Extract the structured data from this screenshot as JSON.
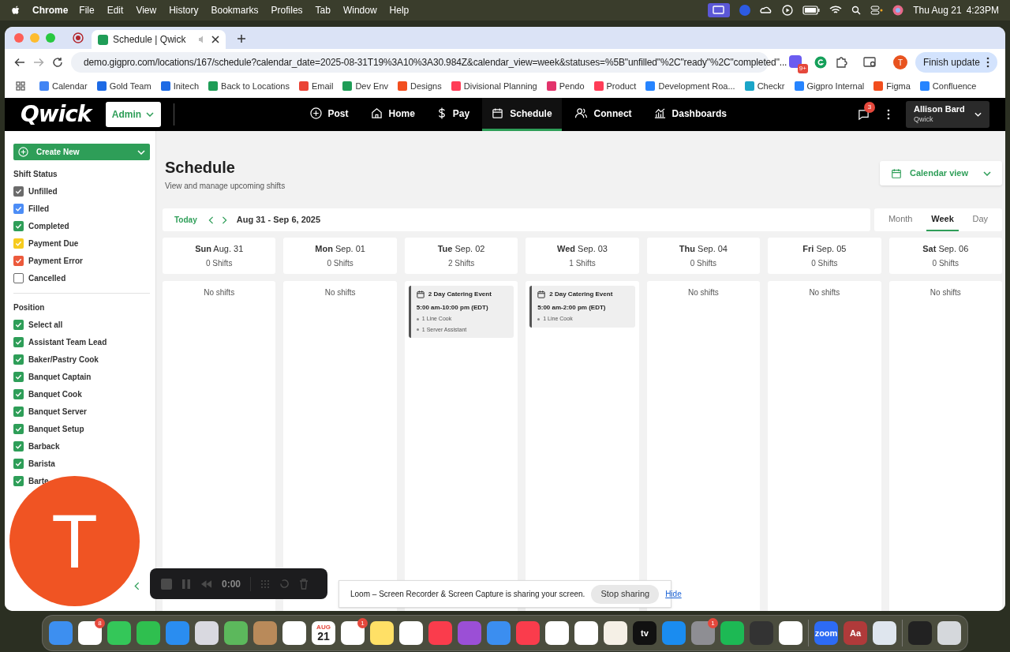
{
  "menubar": {
    "app": "Chrome",
    "menus": [
      "File",
      "Edit",
      "View",
      "History",
      "Bookmarks",
      "Profiles",
      "Tab",
      "Window",
      "Help"
    ],
    "date": "Thu Aug 21",
    "time": "4:23PM"
  },
  "browser": {
    "tab_title": "Schedule | Qwick",
    "url": "demo.gigpro.com/locations/167/schedule?calendar_date=2025-08-31T19%3A10%3A30.984Z&calendar_view=week&statuses=%5B\"unfilled\"%2C\"ready\"%2C\"completed\"...",
    "extension_badge": "9+",
    "profile_initial": "T",
    "update_button": "Finish update",
    "bookmarks": [
      {
        "label": "Calendar",
        "color": "#4285f4"
      },
      {
        "label": "Gold Team",
        "color": "#1d6ae5"
      },
      {
        "label": "Initech",
        "color": "#1d6ae5"
      },
      {
        "label": "Back to Locations",
        "color": "#1f9d57"
      },
      {
        "label": "Email",
        "color": "#ea4335"
      },
      {
        "label": "Dev Env",
        "color": "#1f9d57"
      },
      {
        "label": "Designs",
        "color": "#f24e1e"
      },
      {
        "label": "Divisional Planning",
        "color": "#ff3d57"
      },
      {
        "label": "Pendo",
        "color": "#e2336b"
      },
      {
        "label": "Product",
        "color": "#ff3d57"
      },
      {
        "label": "Development Roa...",
        "color": "#2684ff"
      },
      {
        "label": "Checkr",
        "color": "#1aa5c8"
      },
      {
        "label": "Gigpro Internal",
        "color": "#2684ff"
      },
      {
        "label": "Figma",
        "color": "#f24e1e"
      },
      {
        "label": "Confluence",
        "color": "#2684ff"
      }
    ]
  },
  "app_nav": {
    "logo": "Qwick",
    "role": "Admin",
    "items": [
      {
        "label": "Post",
        "selected": false
      },
      {
        "label": "Home",
        "selected": false
      },
      {
        "label": "Pay",
        "selected": false
      },
      {
        "label": "Schedule",
        "selected": true
      },
      {
        "label": "Connect",
        "selected": false
      },
      {
        "label": "Dashboards",
        "selected": false
      }
    ],
    "notification_count": "3",
    "user_name": "Allison Bard",
    "user_org": "Qwick"
  },
  "sidebar": {
    "create_button": "Create New",
    "shift_status": {
      "heading": "Shift Status",
      "items": [
        {
          "label": "Unfilled",
          "checked": true,
          "color": "#6b6b6b"
        },
        {
          "label": "Filled",
          "checked": true,
          "color": "#4c8df6"
        },
        {
          "label": "Completed",
          "checked": true,
          "color": "#2f9e58"
        },
        {
          "label": "Payment Due",
          "checked": true,
          "color": "#f6cb1e"
        },
        {
          "label": "Payment Error",
          "checked": true,
          "color": "#ec5a3c"
        },
        {
          "label": "Cancelled",
          "checked": false,
          "color": "#6b6b6b"
        }
      ]
    },
    "position": {
      "heading": "Position",
      "items": [
        {
          "label": "Select all",
          "checked": true
        },
        {
          "label": "Assistant Team Lead",
          "checked": true
        },
        {
          "label": "Baker/Pastry Cook",
          "checked": true
        },
        {
          "label": "Banquet Captain",
          "checked": true
        },
        {
          "label": "Banquet Cook",
          "checked": true
        },
        {
          "label": "Banquet Server",
          "checked": true
        },
        {
          "label": "Banquet Setup",
          "checked": true
        },
        {
          "label": "Barback",
          "checked": true
        },
        {
          "label": "Barista",
          "checked": true
        },
        {
          "label": "Barte",
          "checked": true
        }
      ]
    }
  },
  "main": {
    "title": "Schedule",
    "subtitle": "View and manage upcoming shifts",
    "view_button": "Calendar view",
    "today_button": "Today",
    "range": "Aug 31 - Sep 6, 2025",
    "views": [
      {
        "label": "Month",
        "selected": false
      },
      {
        "label": "Week",
        "selected": true
      },
      {
        "label": "Day",
        "selected": false
      }
    ],
    "days": [
      {
        "weekday": "Sun",
        "date": "Aug. 31",
        "count": "0 Shifts",
        "empty_text": "No shifts"
      },
      {
        "weekday": "Mon",
        "date": "Sep. 01",
        "count": "0 Shifts",
        "empty_text": "No shifts"
      },
      {
        "weekday": "Tue",
        "date": "Sep. 02",
        "count": "2 Shifts",
        "shifts": [
          {
            "title": "2 Day Catering Event",
            "time": "5:00 am-10:00 pm (EDT)",
            "positions": [
              "1 Line Cook",
              "1 Server Assistant"
            ]
          }
        ]
      },
      {
        "weekday": "Wed",
        "date": "Sep. 03",
        "count": "1 Shifts",
        "shifts": [
          {
            "title": "2 Day Catering Event",
            "time": "5:00 am-2:00 pm (EDT)",
            "positions": [
              "1 Line Cook"
            ]
          }
        ]
      },
      {
        "weekday": "Thu",
        "date": "Sep. 04",
        "count": "0 Shifts",
        "empty_text": "No shifts"
      },
      {
        "weekday": "Fri",
        "date": "Sep. 05",
        "count": "0 Shifts",
        "empty_text": "No shifts"
      },
      {
        "weekday": "Sat",
        "date": "Sep. 06",
        "count": "0 Shifts",
        "empty_text": "No shifts"
      }
    ]
  },
  "loom": {
    "initial": "T",
    "timer": "0:00",
    "banner": "Loom – Screen Recorder & Screen Capture is sharing your screen.",
    "stop_button": "Stop sharing",
    "hide_link": "Hide"
  },
  "dock": {
    "apps": [
      {
        "color": "#3d8ff0"
      },
      {
        "color": "#ffffff",
        "badge": "8"
      },
      {
        "color": "#34c759"
      },
      {
        "color": "#2fbf4f"
      },
      {
        "color": "#2a8df0"
      },
      {
        "color": "#d9d9e0"
      },
      {
        "color": "#5cb85c"
      },
      {
        "color": "#b98a5a"
      },
      {
        "color": "#ffffff"
      },
      {
        "color": "#ffffff",
        "month": "AUG",
        "text": "21"
      },
      {
        "color": "#ffffff",
        "badge": "1"
      },
      {
        "color": "#ffe066"
      },
      {
        "color": "#ffffff"
      },
      {
        "color": "#fa3c4c"
      },
      {
        "color": "#9b4fd6"
      },
      {
        "color": "#3b8ef0"
      },
      {
        "color": "#fa3c4c"
      },
      {
        "color": "#ffffff"
      },
      {
        "color": "#ffffff"
      },
      {
        "color": "#f5f0e6"
      },
      {
        "color": "#111111",
        "text": "tv"
      },
      {
        "color": "#1a8cf0"
      },
      {
        "color": "#8e8e93",
        "badge": "1"
      },
      {
        "color": "#1db954"
      },
      {
        "color": "#333333"
      },
      {
        "color": "#ffffff"
      },
      {
        "color": "#2d6bf5",
        "text": "zoom"
      },
      {
        "color": "#b03a3a",
        "text": "Aa"
      },
      {
        "color": "#dfe6ee"
      },
      {
        "color": "#222222"
      },
      {
        "color": "#d5d8dc"
      }
    ]
  }
}
